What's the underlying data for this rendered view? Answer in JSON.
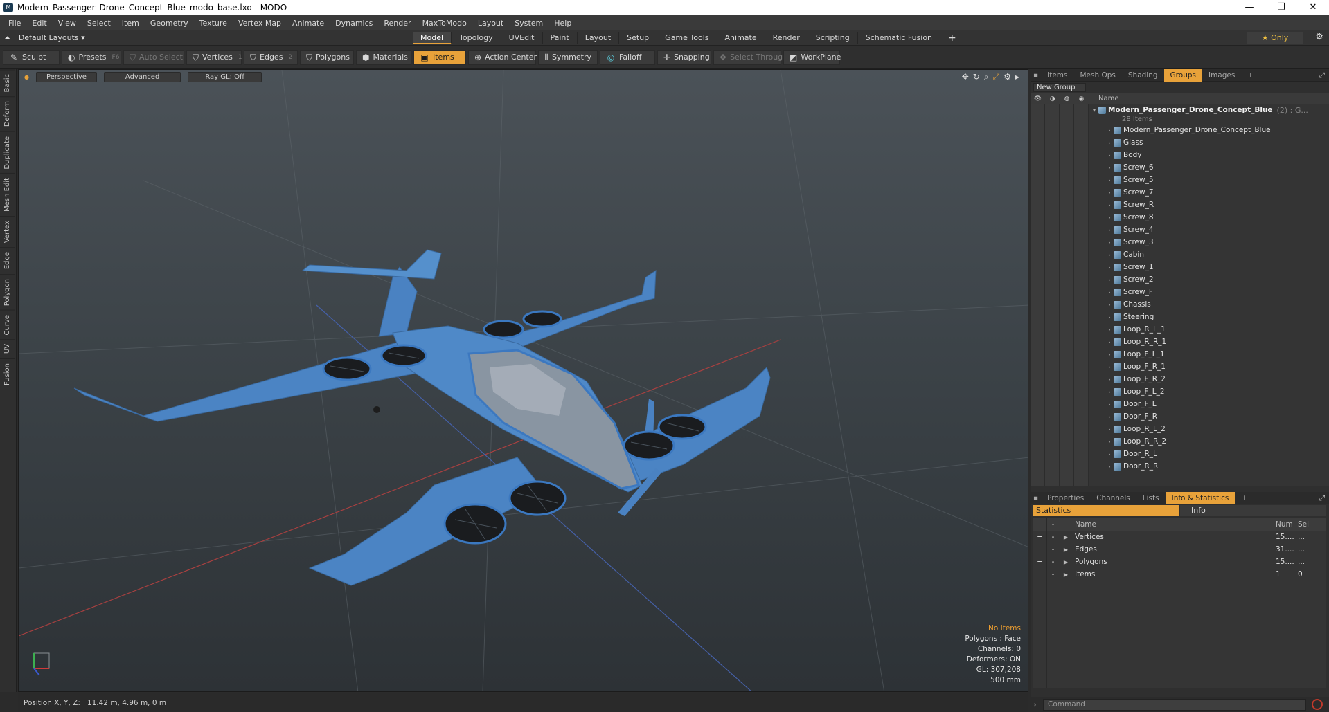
{
  "window": {
    "title": "Modern_Passenger_Drone_Concept_Blue_modo_base.lxo - MODO",
    "app_icon": "modo-icon",
    "controls": [
      "—",
      "❐",
      "✕"
    ]
  },
  "menu": [
    "File",
    "Edit",
    "View",
    "Select",
    "Item",
    "Geometry",
    "Texture",
    "Vertex Map",
    "Animate",
    "Dynamics",
    "Render",
    "MaxToModo",
    "Layout",
    "System",
    "Help"
  ],
  "layout": {
    "selector": "Default Layouts ▾",
    "tabs": [
      "Model",
      "Topology",
      "UVEdit",
      "Paint",
      "Layout",
      "Setup",
      "Game Tools",
      "Animate",
      "Render",
      "Scripting",
      "Schematic Fusion",
      "+"
    ],
    "active_tab": "Model",
    "only_label": "★  Only"
  },
  "toolbar": {
    "sculpt": "Sculpt",
    "presets": "Presets",
    "presets_key": "F6",
    "auto_select": "Auto Select",
    "vertices": "Vertices",
    "vertices_num": "1",
    "edges": "Edges",
    "edges_num": "2",
    "polygons": "Polygons",
    "materials": "Materials",
    "items": "Items",
    "action_center": "Action Center",
    "symmetry": "Symmetry",
    "falloff": "Falloff",
    "snapping": "Snapping",
    "select_through": "Select Through",
    "workplane": "WorkPlane"
  },
  "left_tabs": [
    "Basic",
    "Deform",
    "Duplicate",
    "Mesh Edit",
    "Vertex",
    "Edge",
    "Polygon",
    "Curve",
    "UV",
    "Fusion"
  ],
  "viewport": {
    "perspective": "Perspective",
    "advanced": "Advanced",
    "raygl": "Ray GL: Off",
    "info": {
      "no_items": "No Items",
      "polygons": "Polygons : Face",
      "channels": "Channels: 0",
      "deformers": "Deformers: ON",
      "gl": "GL: 307,208",
      "scale": "500 mm"
    },
    "model_color": "#4b84c4"
  },
  "status": {
    "label": "Position X, Y, Z:",
    "value": "11.42 m, 4.96 m, 0 m"
  },
  "groups_panel": {
    "tabs": [
      "Items",
      "Mesh Ops",
      "Shading",
      "Groups",
      "Images",
      "+"
    ],
    "active_tab": "Groups",
    "new_group": "New Group",
    "name_header": "Name",
    "root": {
      "name": "Modern_Passenger_Drone_Concept_Blue",
      "suffix": "(2) : G...",
      "count": "28 Items"
    },
    "items": [
      "Modern_Passenger_Drone_Concept_Blue",
      "Glass",
      "Body",
      "Screw_6",
      "Screw_5",
      "Screw_7",
      "Screw_R",
      "Screw_8",
      "Screw_4",
      "Screw_3",
      "Cabin",
      "Screw_1",
      "Screw_2",
      "Screw_F",
      "Chassis",
      "Steering",
      "Loop_R_L_1",
      "Loop_R_R_1",
      "Loop_F_L_1",
      "Loop_F_R_1",
      "Loop_F_R_2",
      "Loop_F_L_2",
      "Door_F_L",
      "Door_F_R",
      "Loop_R_L_2",
      "Loop_R_R_2",
      "Door_R_L",
      "Door_R_R"
    ]
  },
  "props_panel": {
    "tabs": [
      "Properties",
      "Channels",
      "Lists",
      "Info & Statistics",
      "+"
    ],
    "active_tab": "Info & Statistics",
    "stat_tab": "Statistics",
    "info_tab": "Info",
    "columns": [
      "Name",
      "Num",
      "Sel"
    ],
    "rows": [
      {
        "name": "Vertices",
        "num": "15....",
        "sel": "..."
      },
      {
        "name": "Edges",
        "num": "31....",
        "sel": "..."
      },
      {
        "name": "Polygons",
        "num": "15....",
        "sel": "..."
      },
      {
        "name": "Items",
        "num": "1",
        "sel": "0"
      }
    ]
  },
  "command": {
    "placeholder": "Command"
  }
}
